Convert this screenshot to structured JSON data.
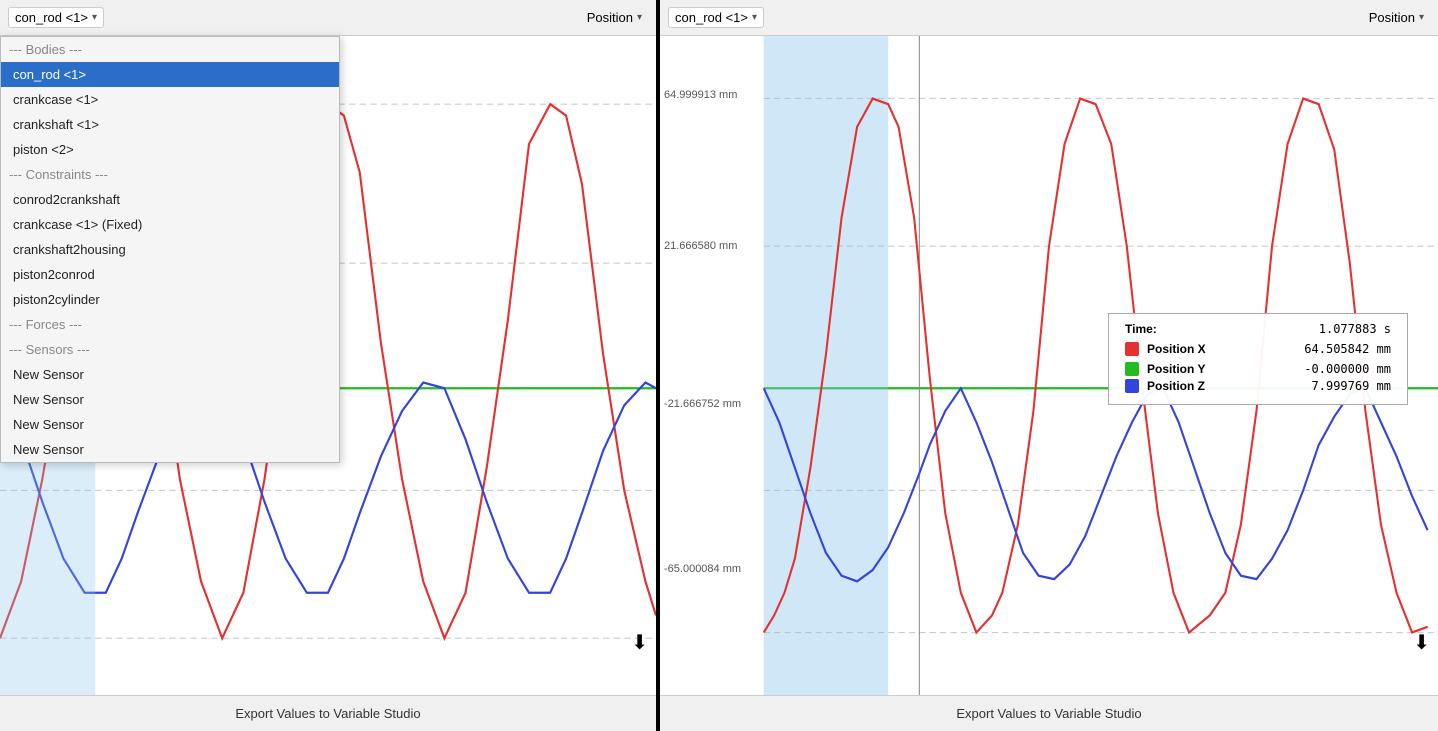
{
  "left_panel": {
    "selector": {
      "label": "con_rod <1>",
      "arrow": "▾"
    },
    "position_dropdown": {
      "label": "Position",
      "arrow": "▾"
    },
    "dropdown_open": true,
    "menu_items": [
      {
        "id": "bodies-sep",
        "text": "--- Bodies ---",
        "type": "separator"
      },
      {
        "id": "con_rod",
        "text": "con_rod <1>",
        "type": "item",
        "selected": true
      },
      {
        "id": "crankcase",
        "text": "crankcase <1>",
        "type": "item"
      },
      {
        "id": "crankshaft",
        "text": "crankshaft <1>",
        "type": "item"
      },
      {
        "id": "piston",
        "text": "piston <2>",
        "type": "item"
      },
      {
        "id": "constraints-sep",
        "text": "--- Constraints ---",
        "type": "separator"
      },
      {
        "id": "conrod2crankshaft",
        "text": "conrod2crankshaft",
        "type": "item"
      },
      {
        "id": "crankcase_fixed",
        "text": "crankcase <1> (Fixed)",
        "type": "item"
      },
      {
        "id": "crankshaft2housing",
        "text": "crankshaft2housing",
        "type": "item"
      },
      {
        "id": "piston2conrod",
        "text": "piston2conrod",
        "type": "item"
      },
      {
        "id": "piston2cylinder",
        "text": "piston2cylinder",
        "type": "item"
      },
      {
        "id": "forces-sep",
        "text": "--- Forces ---",
        "type": "separator"
      },
      {
        "id": "sensors-sep",
        "text": "--- Sensors ---",
        "type": "separator"
      },
      {
        "id": "new_sensor_1",
        "text": "New Sensor",
        "type": "item"
      },
      {
        "id": "new_sensor_2",
        "text": "New Sensor",
        "type": "item"
      },
      {
        "id": "new_sensor_3",
        "text": "New Sensor",
        "type": "item"
      },
      {
        "id": "new_sensor_4",
        "text": "New Sensor",
        "type": "item"
      }
    ],
    "export_label": "Export Values to Variable Studio"
  },
  "right_panel": {
    "selector": {
      "label": "con_rod <1>",
      "arrow": "▾"
    },
    "position_dropdown": {
      "label": "Position",
      "arrow": "▾"
    },
    "export_label": "Export Values to Variable Studio",
    "y_labels": [
      {
        "value": "64.999913 mm",
        "pct": 8
      },
      {
        "value": "21.666580 mm",
        "pct": 32
      },
      {
        "value": "-21.666752 mm",
        "pct": 57
      },
      {
        "value": "-65.000084 mm",
        "pct": 82
      }
    ],
    "tooltip": {
      "time_label": "Time:",
      "time_value": "1.077883 s",
      "rows": [
        {
          "color": "#e53030",
          "label": "Position X",
          "value": "64.505842 mm"
        },
        {
          "color": "#22bb22",
          "label": "Position Y",
          "value": "-0.000000 mm"
        },
        {
          "color": "#3344dd",
          "label": "Position Z",
          "value": "7.999769 mm"
        }
      ]
    },
    "download_icon": "⬇"
  },
  "left_download_icon": "⬇"
}
